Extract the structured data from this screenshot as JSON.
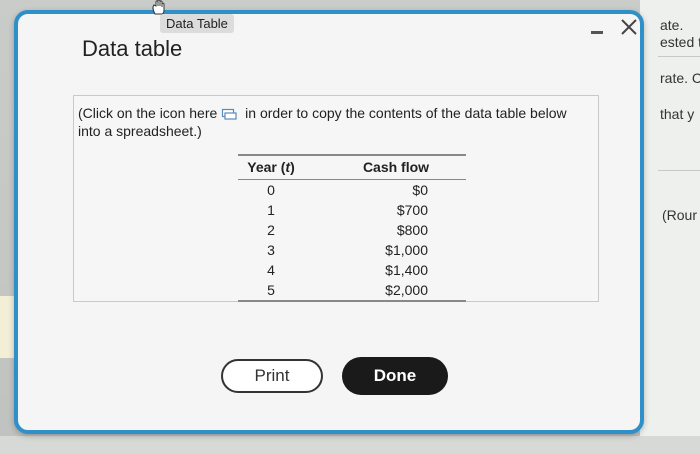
{
  "tooltip": "Data Table",
  "dialog": {
    "title": "Data table",
    "instruction_before": "(Click on the icon here",
    "instruction_after": " in order to copy the contents of the data table below into a spreadsheet.)"
  },
  "table": {
    "headers": [
      "Year (t)",
      "Cash flow"
    ],
    "rows": [
      {
        "year": "0",
        "cash": "$0"
      },
      {
        "year": "1",
        "cash": "$700"
      },
      {
        "year": "2",
        "cash": "$800"
      },
      {
        "year": "3",
        "cash": "$1,000"
      },
      {
        "year": "4",
        "cash": "$1,400"
      },
      {
        "year": "5",
        "cash": "$2,000"
      }
    ]
  },
  "buttons": {
    "print": "Print",
    "done": "Done"
  },
  "background_text": [
    "ate.",
    "ested t",
    "rate. C",
    "that y",
    "(Rour"
  ],
  "colors": {
    "modal_border": "#2f8fc9",
    "done_bg": "#1a1a1a"
  }
}
